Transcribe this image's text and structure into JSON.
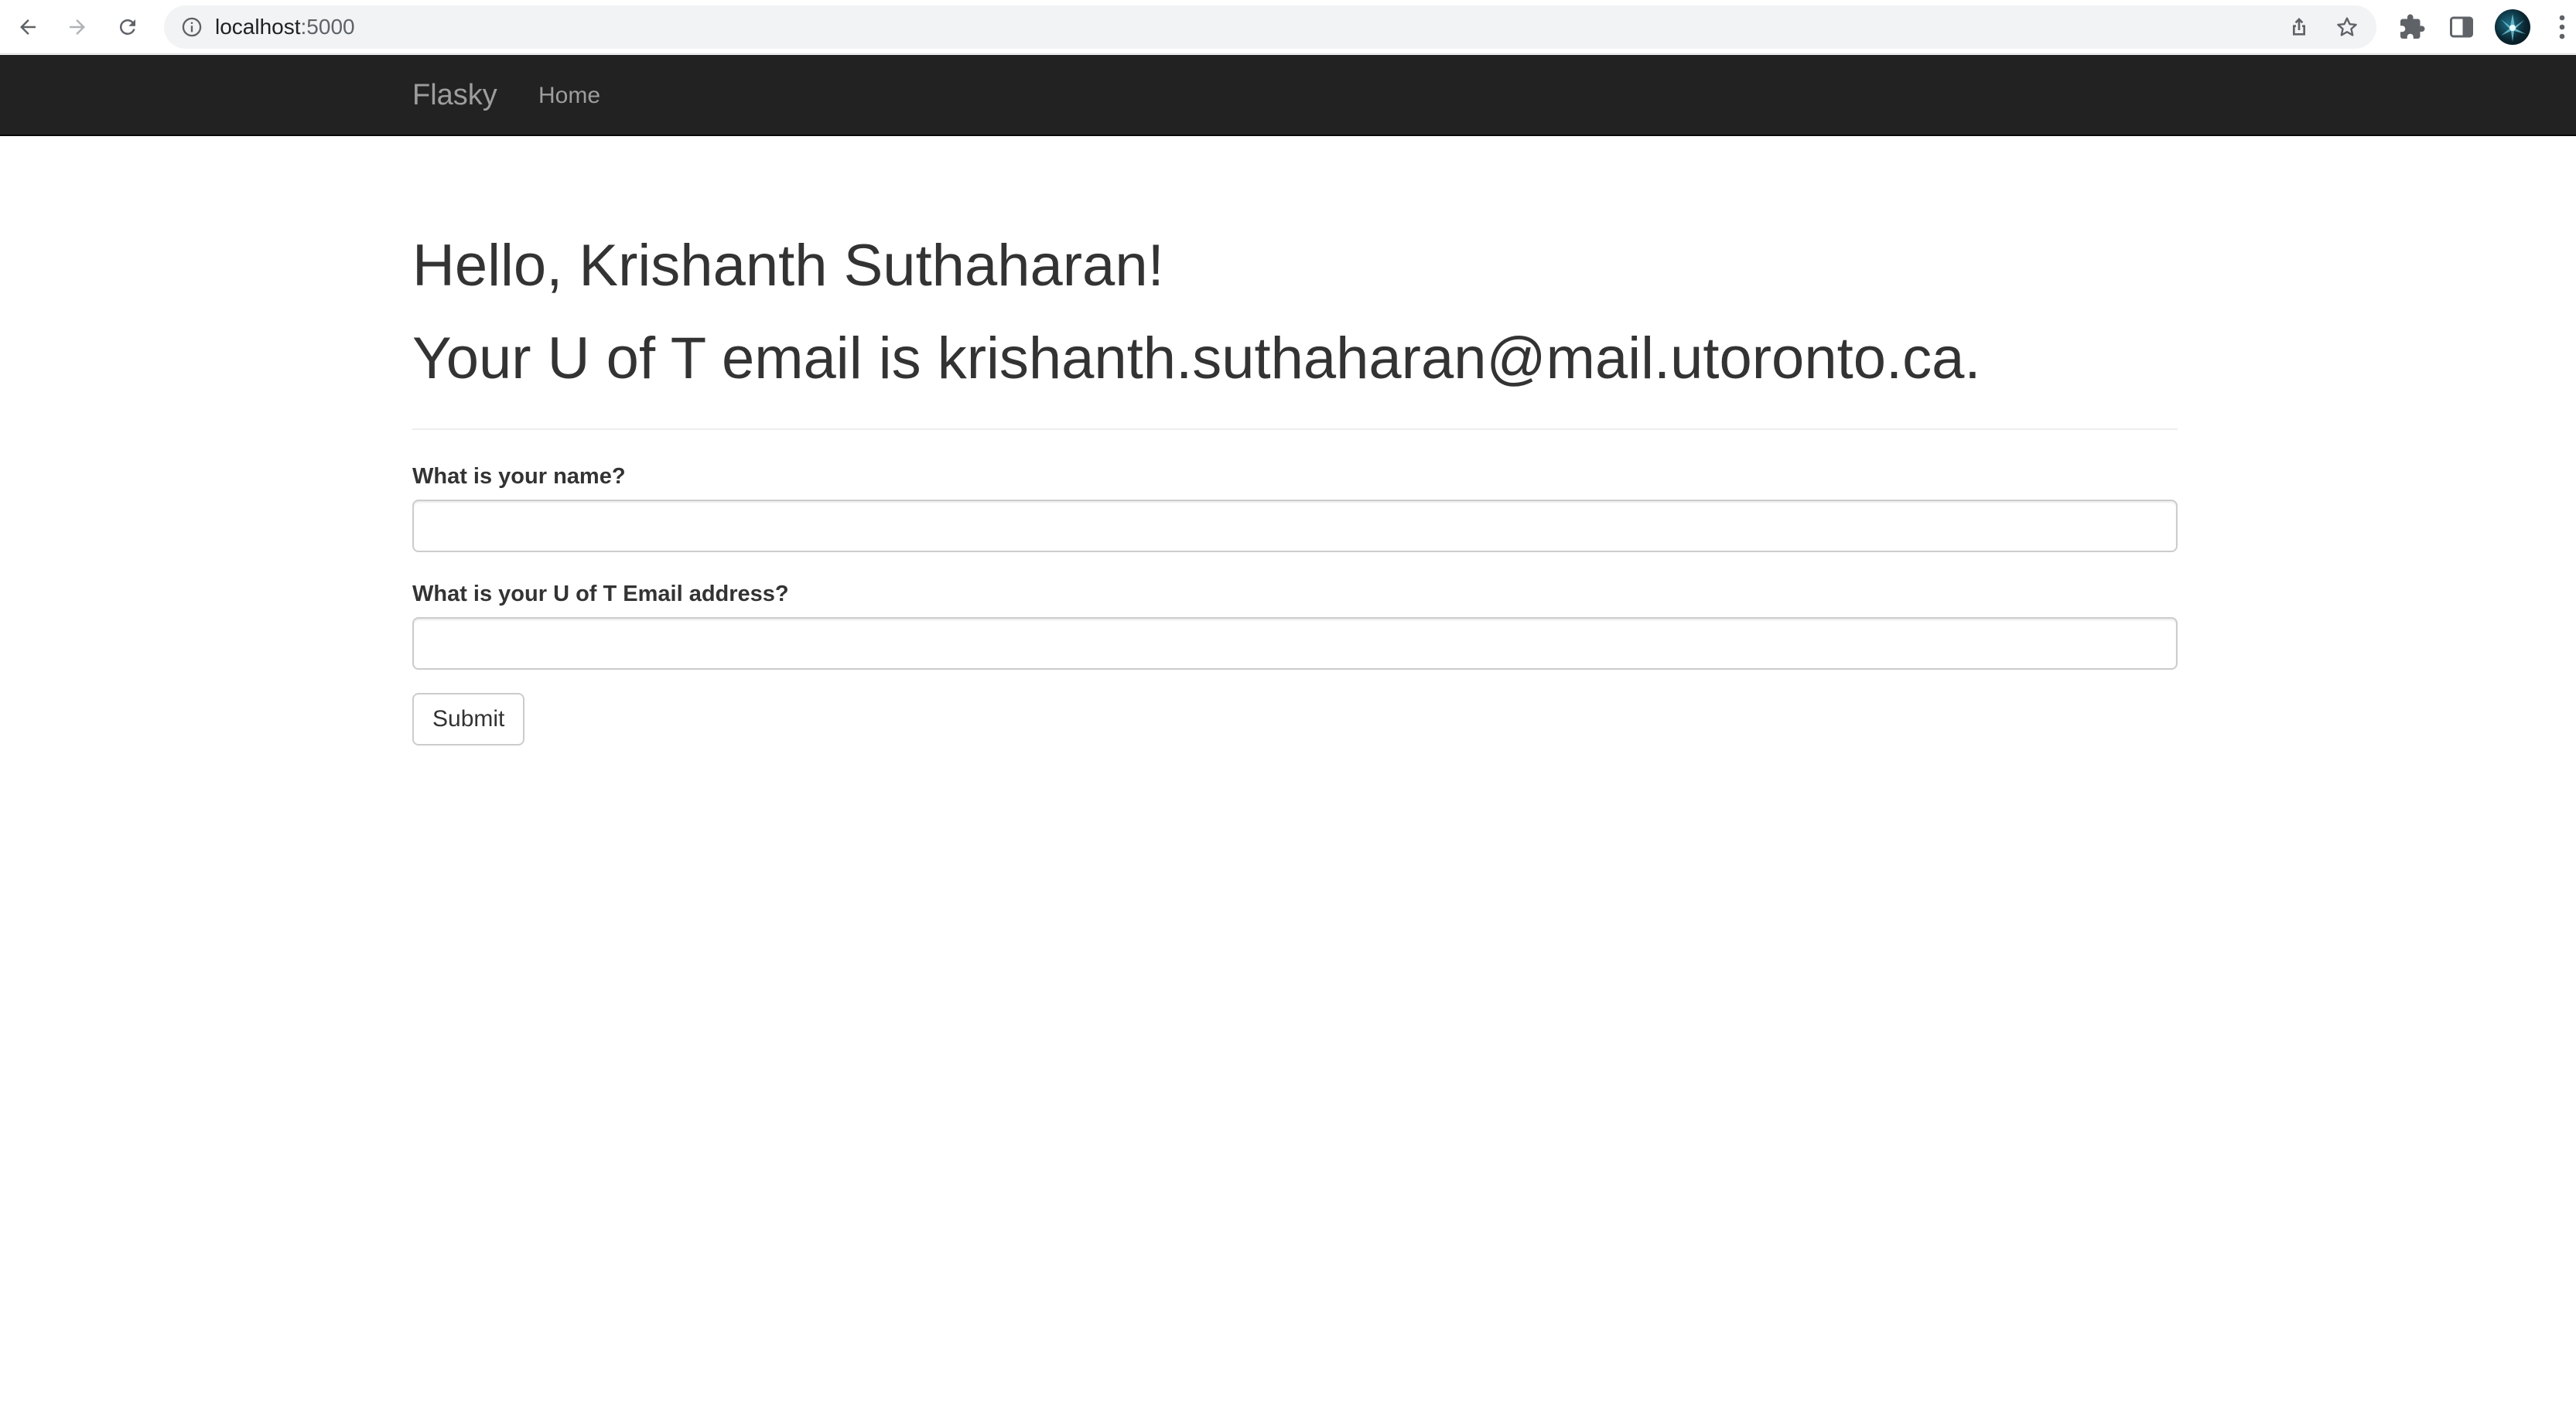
{
  "browser": {
    "url_host": "localhost",
    "url_port": ":5000",
    "icons": [
      "back-icon",
      "forward-icon",
      "reload-icon",
      "info-icon",
      "share-icon",
      "bookmark-star-icon",
      "extensions-icon",
      "side-panel-icon",
      "profile-avatar",
      "more-menu-icon"
    ]
  },
  "navbar": {
    "brand": "Flasky",
    "home_label": "Home",
    "background": "#222222",
    "text_color": "#9d9d9d"
  },
  "page": {
    "greeting": "Hello, Krishanth Suthaharan!",
    "email_line": "Your U of T email is krishanth.suthaharan@mail.utoronto.ca."
  },
  "form": {
    "name_label": "What is your name?",
    "name_value": "",
    "email_label": "What is your U of T Email address?",
    "email_value": "",
    "submit_label": "Submit"
  }
}
